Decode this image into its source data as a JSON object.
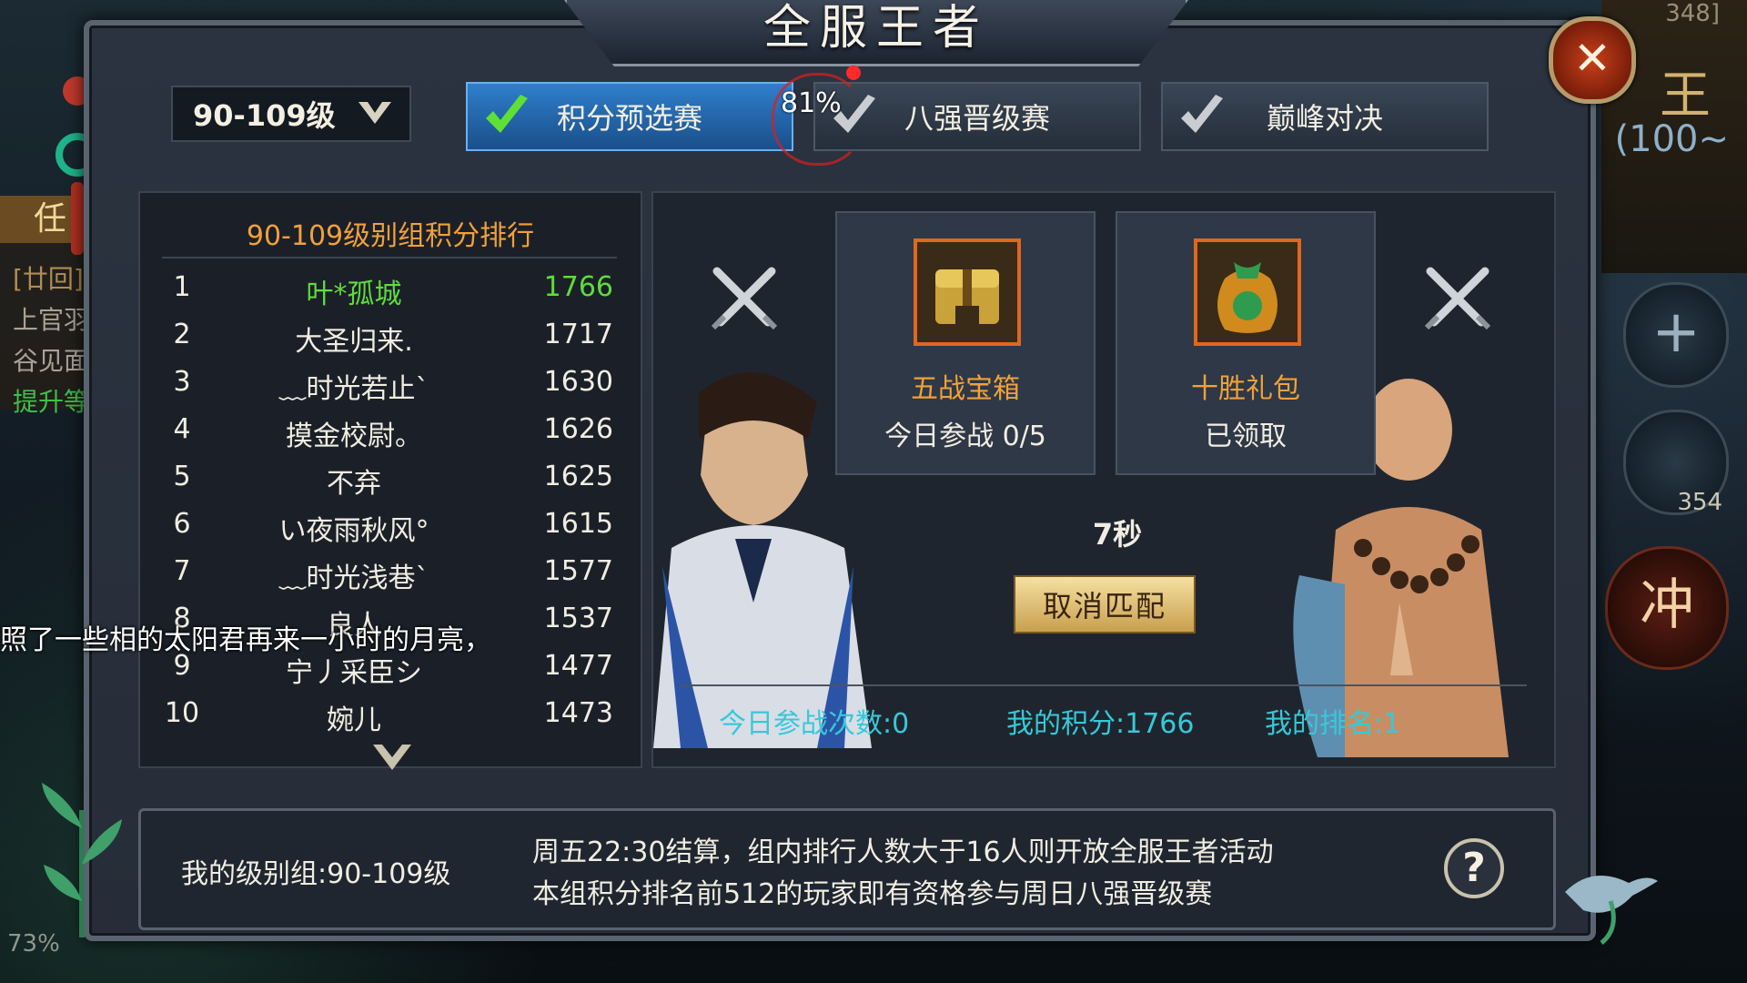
{
  "side_left": {
    "tag": "任",
    "line1": "[廿回]",
    "line2": "上官羽",
    "line3": "谷见面",
    "line4": "提升等",
    "percent": "73%"
  },
  "side_right": {
    "number": "348]",
    "big_char": "王",
    "level_hint": "(100~",
    "potion_count": "354",
    "rush_label": "冲"
  },
  "bubble_text": "照了一些相的太阳君再来一小时的月亮，",
  "dialog": {
    "title": "全服王者",
    "close_label": "✕",
    "level_select": "90-109级",
    "tabs": [
      {
        "label": "积分预选赛",
        "active": true
      },
      {
        "label": "八强晋级赛",
        "active": false
      },
      {
        "label": "巅峰对决",
        "active": false
      }
    ],
    "progress_pct": "81%"
  },
  "ranking": {
    "title": "90-109级别组积分排行",
    "rows": [
      {
        "rank": "1",
        "name": "叶*孤城",
        "score": "1766"
      },
      {
        "rank": "2",
        "name": "大圣归来.",
        "score": "1717"
      },
      {
        "rank": "3",
        "name": "﹏时光若止ˋ",
        "score": "1630"
      },
      {
        "rank": "4",
        "name": "摸金校尉。",
        "score": "1626"
      },
      {
        "rank": "5",
        "name": "不弃",
        "score": "1625"
      },
      {
        "rank": "6",
        "name": "い夜雨秋风°",
        "score": "1615"
      },
      {
        "rank": "7",
        "name": "﹏时光浅巷ˋ",
        "score": "1577"
      },
      {
        "rank": "8",
        "name": "良人",
        "score": "1537"
      },
      {
        "rank": "9",
        "name": "宁丿采臣シ",
        "score": "1477"
      },
      {
        "rank": "10",
        "name": "婉儿",
        "score": "1473"
      }
    ]
  },
  "rewards": [
    {
      "name": "五战宝箱",
      "status": "今日参战  0/5"
    },
    {
      "name": "十胜礼包",
      "status": "已领取"
    }
  ],
  "timer": "7秒",
  "cancel_button": "取消匹配",
  "stats": {
    "today_battles": "今日参战次数:0",
    "my_score": "我的积分:1766",
    "my_rank": "我的排名:1"
  },
  "info": {
    "group": "我的级别组:90-109级",
    "line1": "周五22:30结算，组内排行人数大于16人则开放全服王者活动",
    "line2": "本组积分排名前512的玩家即有资格参与周日八强晋级赛",
    "help_label": "?"
  },
  "colors": {
    "accent_orange": "#f0a13a",
    "top_rank_green": "#5edc3c",
    "stat_cyan": "#36c9d9",
    "active_tab_blue": "#2f7fcc"
  }
}
